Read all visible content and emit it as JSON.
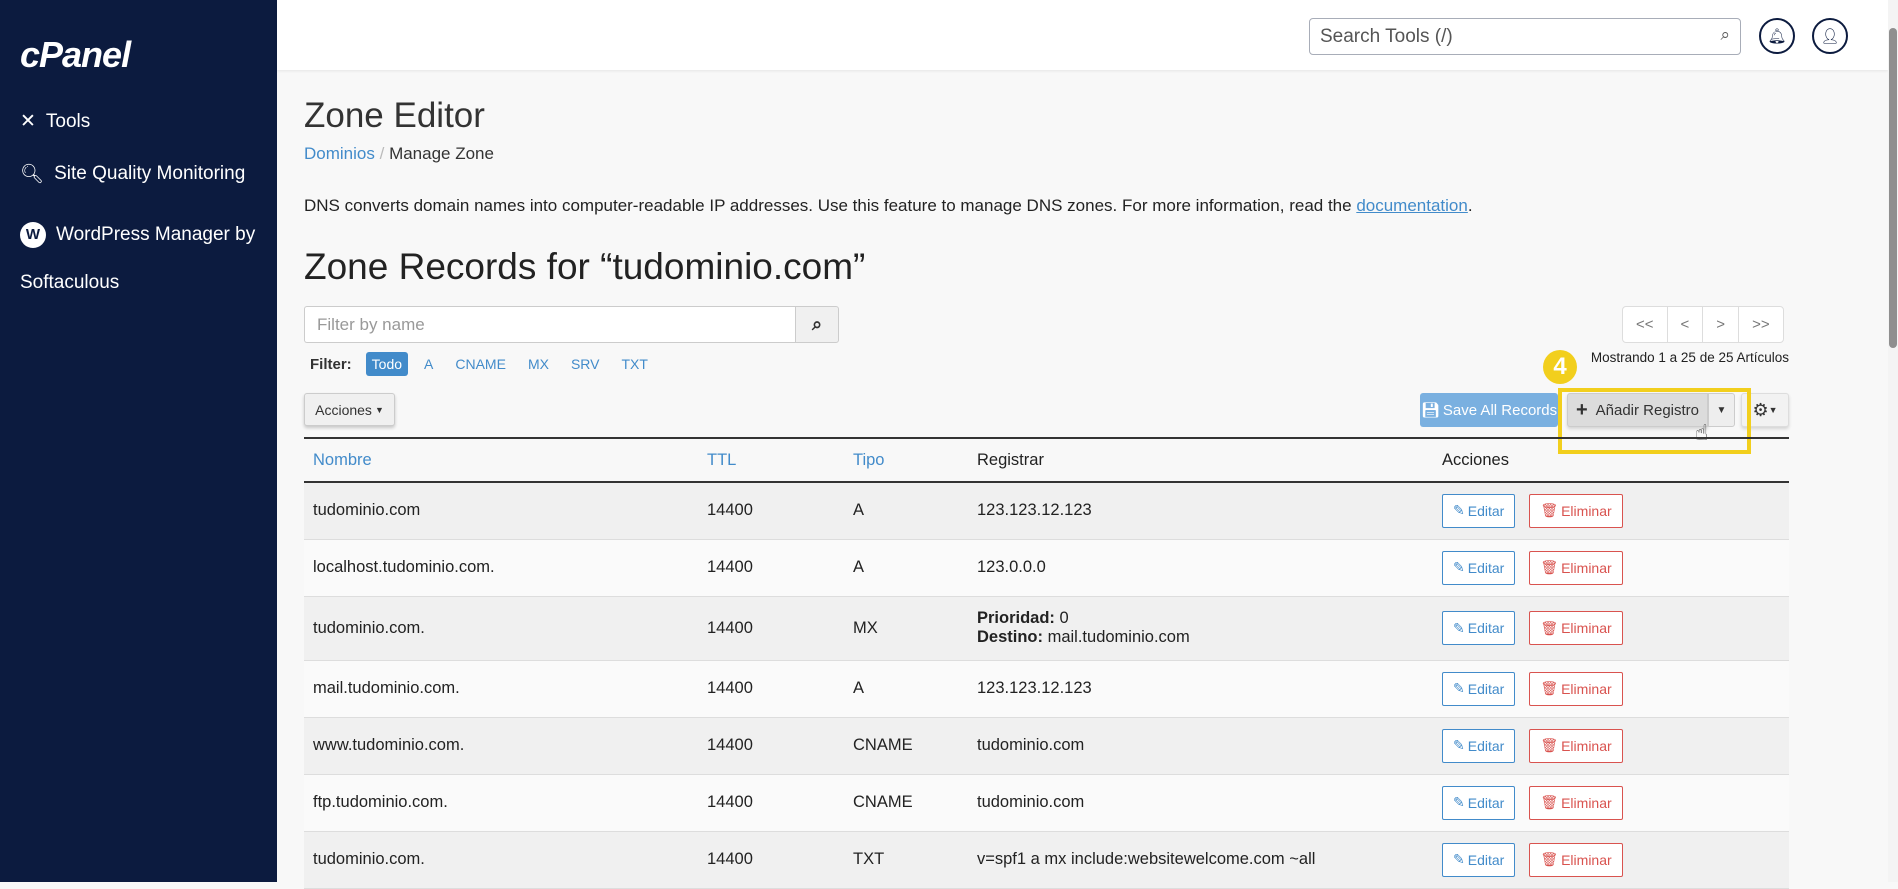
{
  "sidebar": {
    "logo": "cPanel",
    "items": [
      {
        "label": "Tools",
        "icon": "tools-icon"
      },
      {
        "label": "Site Quality Monitoring",
        "icon": "search-check-icon"
      },
      {
        "label": "WordPress Manager by",
        "label2": "Softaculous",
        "icon": "wordpress-icon"
      }
    ]
  },
  "topbar": {
    "search_placeholder": "Search Tools (/)"
  },
  "page": {
    "title": "Zone Editor",
    "breadcrumb": [
      "Dominios",
      "Manage Zone"
    ],
    "description": "DNS converts domain names into computer-readable IP addresses. Use this feature to manage DNS zones. For more information, read the ",
    "doc_link": "documentation",
    "description_end": ".",
    "zone_title": "Zone Records for “tudominio.com”"
  },
  "filter": {
    "placeholder": "Filter by name",
    "label": "Filter:",
    "types": [
      "Todo",
      "A",
      "CNAME",
      "MX",
      "SRV",
      "TXT"
    ],
    "active": "Todo"
  },
  "pager": {
    "first": "<<",
    "prev": "<",
    "next": ">",
    "last": ">>",
    "showing": "Mostrando 1 a 25 de 25 Artículos"
  },
  "toolbar": {
    "actions": "Acciones",
    "save": "Save All Records",
    "add": "Añadir Registro",
    "step_badge": "4",
    "highlight_color": "#f2cf1d"
  },
  "table": {
    "headers": [
      "Nombre",
      "TTL",
      "Tipo",
      "Registrar",
      "Acciones"
    ],
    "edit": "Editar",
    "delete": "Eliminar",
    "rows": [
      {
        "name": "tudominio.com",
        "ttl": "14400",
        "type": "A",
        "record": "123.123.12.123"
      },
      {
        "name": "localhost.tudominio.com.",
        "ttl": "14400",
        "type": "A",
        "record": "123.0.0.0"
      },
      {
        "name": "tudominio.com.",
        "ttl": "14400",
        "type": "MX",
        "priority_label": "Prioridad:",
        "priority": "0",
        "dest_label": "Destino:",
        "dest": "mail.tudominio.com"
      },
      {
        "name": "mail.tudominio.com.",
        "ttl": "14400",
        "type": "A",
        "record": "123.123.12.123"
      },
      {
        "name": "www.tudominio.com.",
        "ttl": "14400",
        "type": "CNAME",
        "record": "tudominio.com"
      },
      {
        "name": "ftp.tudominio.com.",
        "ttl": "14400",
        "type": "CNAME",
        "record": "tudominio.com"
      },
      {
        "name": "tudominio.com.",
        "ttl": "14400",
        "type": "TXT",
        "record": "v=spf1 a mx include:websitewelcome.com ~all"
      }
    ]
  }
}
